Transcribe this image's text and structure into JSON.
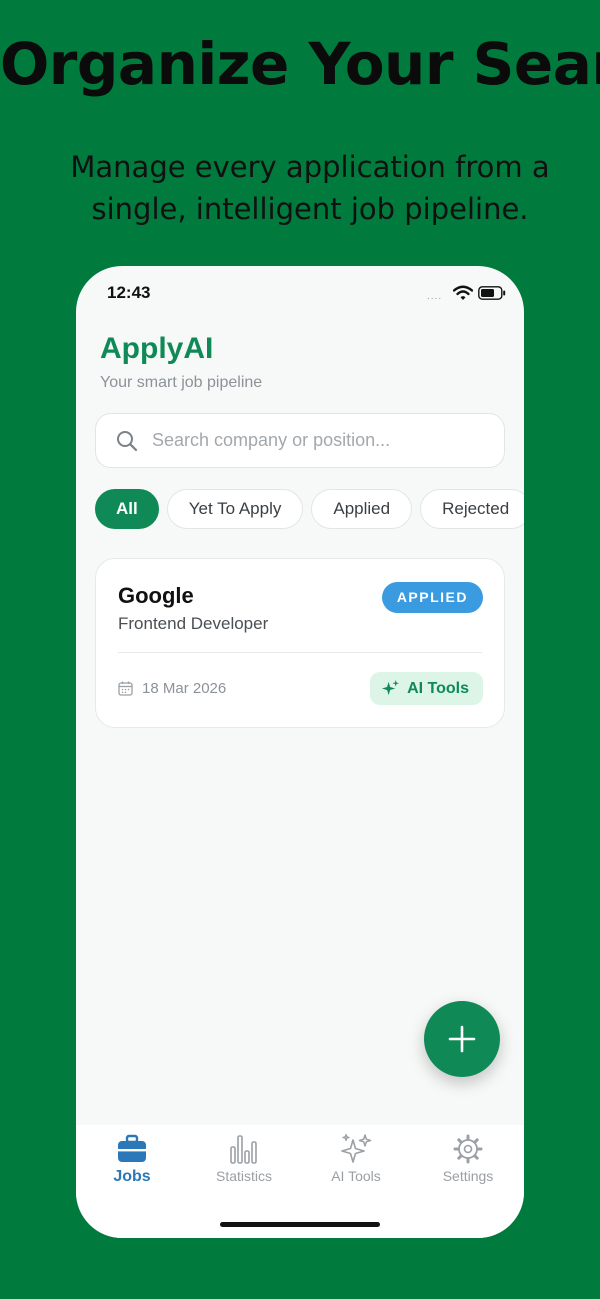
{
  "promo": {
    "headline": "Organize Your Search",
    "subheadline": "Manage every application from a single, intelligent job pipeline."
  },
  "status_bar": {
    "time": "12:43",
    "signal": "....",
    "wifi_icon": "wifi-icon",
    "battery_icon": "battery-icon"
  },
  "app": {
    "title": "ApplyAI",
    "subtitle": "Your smart job pipeline"
  },
  "search": {
    "placeholder": "Search company or position...",
    "value": "",
    "icon": "search-icon"
  },
  "filters": [
    {
      "label": "All",
      "active": true
    },
    {
      "label": "Yet To Apply",
      "active": false
    },
    {
      "label": "Applied",
      "active": false
    },
    {
      "label": "Rejected",
      "active": false
    }
  ],
  "jobs": [
    {
      "company": "Google",
      "position": "Frontend Developer",
      "status": "APPLIED",
      "date": "18 Mar 2026",
      "ai_button": "AI Tools"
    }
  ],
  "fab": {
    "icon": "plus-icon"
  },
  "tabs": [
    {
      "label": "Jobs",
      "icon": "briefcase-icon",
      "active": true
    },
    {
      "label": "Statistics",
      "icon": "bar-chart-icon",
      "active": false
    },
    {
      "label": "AI Tools",
      "icon": "sparkles-icon",
      "active": false
    },
    {
      "label": "Settings",
      "icon": "gear-icon",
      "active": false
    }
  ],
  "colors": {
    "background": "#007a3d",
    "brand": "#0f8a57",
    "applied_badge": "#3a9be0",
    "active_tab": "#2a78b7"
  }
}
